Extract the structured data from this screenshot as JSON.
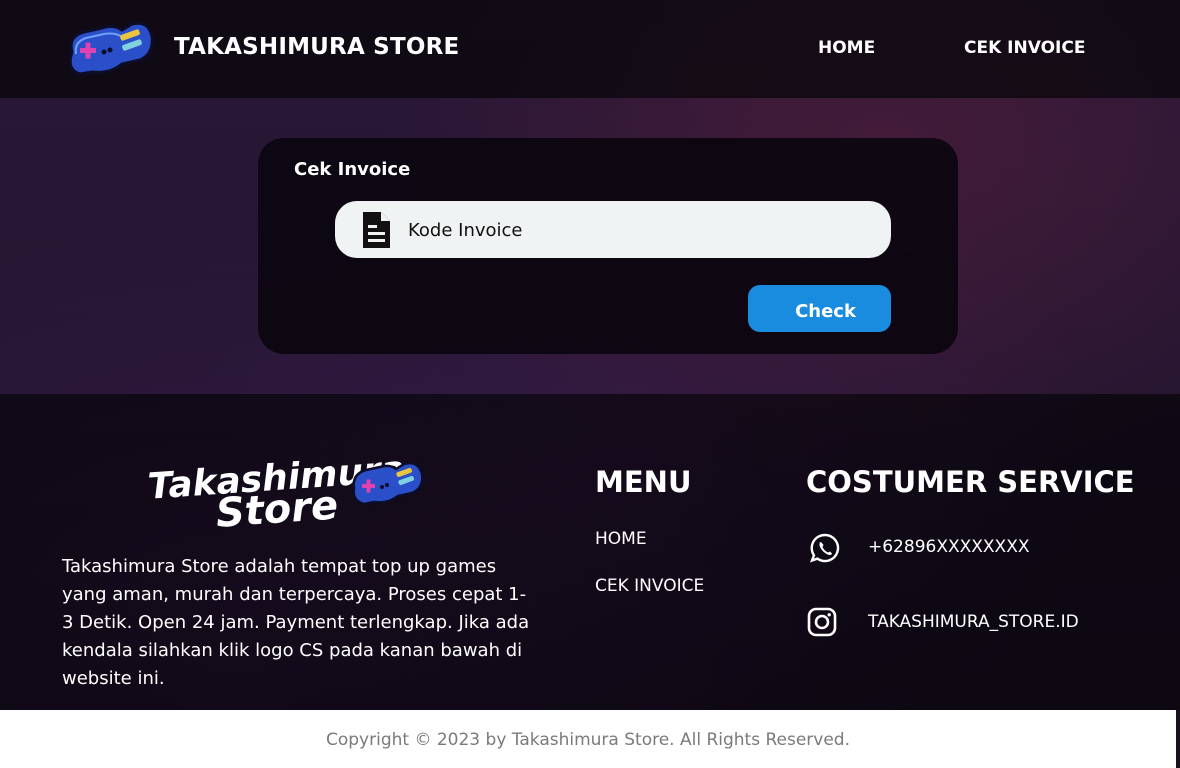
{
  "header": {
    "brand": "TAKASHIMURA STORE",
    "nav": {
      "home": "HOME",
      "cek_invoice": "CEK INVOICE"
    },
    "logo_icon": "gamepad-logo-icon"
  },
  "invoice_card": {
    "title": "Cek Invoice",
    "input_placeholder": "Kode Invoice",
    "input_value": "",
    "input_icon": "document-icon",
    "check_button": "Check"
  },
  "footer": {
    "logo_text": "Takashimura Store",
    "description": "Takashimura Store adalah tempat top up games yang aman, murah dan terpercaya. Proses cepat 1-3 Detik. Open 24 jam. Payment terlengkap. Jika ada kendala silahkan klik logo CS pada kanan bawah di website ini.",
    "menu": {
      "title": "MENU",
      "items": [
        "HOME",
        "CEK INVOICE"
      ]
    },
    "customer_service": {
      "title": "COSTUMER SERVICE",
      "whatsapp": "+62896XXXXXXXX",
      "instagram": "TAKASHIMURA_STORE.ID"
    },
    "copyright": "Copyright © 2023 by Takashimura Store. All Rights Reserved."
  },
  "colors": {
    "accent_button": "#1a8ce0",
    "input_bg": "#f0f3f3",
    "card_bg": "#0a060e"
  }
}
